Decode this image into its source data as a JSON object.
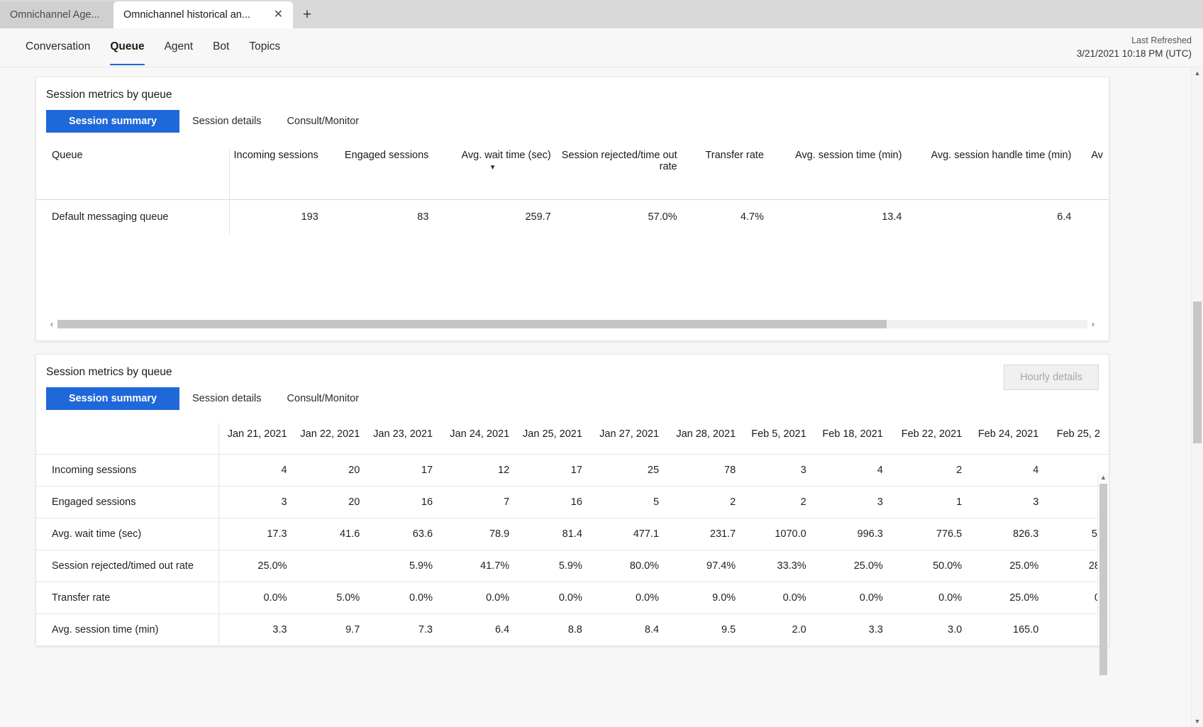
{
  "browser": {
    "tabs": [
      {
        "label": "Omnichannel Age...",
        "active": false
      },
      {
        "label": "Omnichannel historical an...",
        "active": true
      }
    ],
    "close_icon": "✕",
    "new_tab_icon": "+"
  },
  "nav": {
    "tabs": [
      {
        "label": "Conversation",
        "active": false
      },
      {
        "label": "Queue",
        "active": true
      },
      {
        "label": "Agent",
        "active": false
      },
      {
        "label": "Bot",
        "active": false
      },
      {
        "label": "Topics",
        "active": false
      }
    ],
    "refresh_label": "Last Refreshed",
    "refresh_time": "3/21/2021 10:18 PM (UTC)"
  },
  "panel1": {
    "title": "Session metrics by queue",
    "subtabs": [
      {
        "label": "Session summary",
        "active": true
      },
      {
        "label": "Session details",
        "active": false
      },
      {
        "label": "Consult/Monitor",
        "active": false
      }
    ],
    "columns": [
      "Queue",
      "Incoming sessions",
      "Engaged sessions",
      "Avg. wait time (sec)",
      "Session rejected/time out rate",
      "Transfer rate",
      "Avg. session time (min)",
      "Avg. session handle time (min)",
      "Av"
    ],
    "sorted_column_index": 3,
    "sort_caret": "▼",
    "rows": [
      [
        "Default messaging queue",
        "193",
        "83",
        "259.7",
        "57.0%",
        "4.7%",
        "13.4",
        "6.4",
        ""
      ]
    ],
    "hscroll": {
      "left_arrow": "‹",
      "right_arrow": "›",
      "thumb_percent": 80
    }
  },
  "panel2": {
    "title": "Session metrics by queue",
    "hourly_button": "Hourly details",
    "subtabs": [
      {
        "label": "Session summary",
        "active": true
      },
      {
        "label": "Session details",
        "active": false
      },
      {
        "label": "Consult/Monitor",
        "active": false
      }
    ],
    "dates": [
      "Jan 21, 2021",
      "Jan 22, 2021",
      "Jan 23, 2021",
      "Jan 24, 2021",
      "Jan 25, 2021",
      "Jan 27, 2021",
      "Jan 28, 2021",
      "Feb 5, 2021",
      "Feb 18, 2021",
      "Feb 22, 2021",
      "Feb 24, 2021",
      "Feb 25, 2"
    ],
    "rows": [
      {
        "metric": "Incoming sessions",
        "values": [
          "4",
          "20",
          "17",
          "12",
          "17",
          "25",
          "78",
          "3",
          "4",
          "2",
          "4",
          ""
        ]
      },
      {
        "metric": "Engaged sessions",
        "values": [
          "3",
          "20",
          "16",
          "7",
          "16",
          "5",
          "2",
          "2",
          "3",
          "1",
          "3",
          ""
        ]
      },
      {
        "metric": "Avg. wait time (sec)",
        "values": [
          "17.3",
          "41.6",
          "63.6",
          "78.9",
          "81.4",
          "477.1",
          "231.7",
          "1070.0",
          "996.3",
          "776.5",
          "826.3",
          "5."
        ]
      },
      {
        "metric": "Session rejected/timed out rate",
        "values": [
          "25.0%",
          "",
          "5.9%",
          "41.7%",
          "5.9%",
          "80.0%",
          "97.4%",
          "33.3%",
          "25.0%",
          "50.0%",
          "25.0%",
          "28"
        ]
      },
      {
        "metric": "Transfer rate",
        "values": [
          "0.0%",
          "5.0%",
          "0.0%",
          "0.0%",
          "0.0%",
          "0.0%",
          "9.0%",
          "0.0%",
          "0.0%",
          "0.0%",
          "25.0%",
          "0"
        ]
      },
      {
        "metric": "Avg. session time (min)",
        "values": [
          "3.3",
          "9.7",
          "7.3",
          "6.4",
          "8.8",
          "8.4",
          "9.5",
          "2.0",
          "3.3",
          "3.0",
          "165.0",
          ""
        ]
      }
    ],
    "vscroll": {
      "up_arrow": "▲"
    }
  },
  "page_scroll": {
    "up_arrow": "▲",
    "down_arrow": "▼"
  },
  "colors": {
    "accent": "#1f68d9",
    "tab_underline": "#2266dd",
    "panel_bg": "#ffffff",
    "page_bg": "#f7f7f7"
  }
}
